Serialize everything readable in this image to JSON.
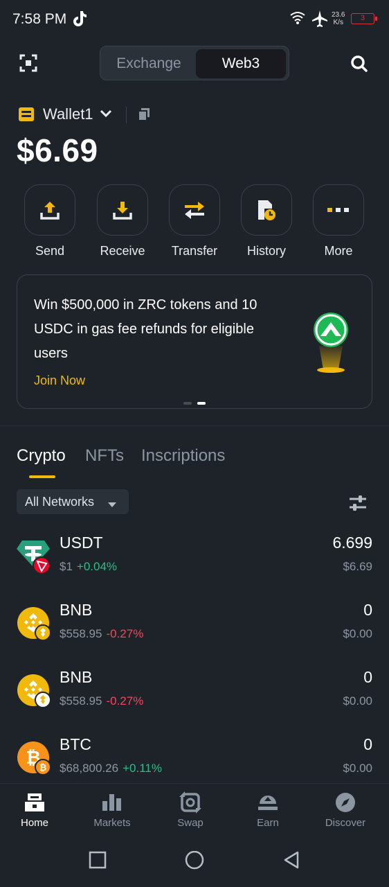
{
  "status_bar": {
    "time": "7:58 PM",
    "speed_value": "23.6",
    "speed_unit": "K/s",
    "battery": "3"
  },
  "header": {
    "tabs": [
      "Exchange",
      "Web3"
    ],
    "active_tab": "Web3"
  },
  "wallet": {
    "name": "Wallet1",
    "balance": "$6.69"
  },
  "actions": [
    {
      "label": "Send",
      "icon": "send-icon"
    },
    {
      "label": "Receive",
      "icon": "receive-icon"
    },
    {
      "label": "Transfer",
      "icon": "transfer-icon"
    },
    {
      "label": "History",
      "icon": "history-icon"
    },
    {
      "label": "More",
      "icon": "more-icon"
    }
  ],
  "promo": {
    "text": "Win $500,000 in ZRC tokens and 10 USDC in gas fee refunds for eligible users",
    "cta": "Join Now",
    "page_count": 2,
    "active_page": 2
  },
  "asset_tabs": [
    "Crypto",
    "NFTs",
    "Inscriptions"
  ],
  "network_filter": "All Networks",
  "assets": [
    {
      "name": "USDT",
      "price": "$1",
      "change": "+0.04%",
      "direction": "up",
      "amount": "6.699",
      "value": "$6.69"
    },
    {
      "name": "BNB",
      "price": "$558.95",
      "change": "-0.27%",
      "direction": "down",
      "amount": "0",
      "value": "$0.00"
    },
    {
      "name": "BNB",
      "price": "$558.95",
      "change": "-0.27%",
      "direction": "down",
      "amount": "0",
      "value": "$0.00"
    },
    {
      "name": "BTC",
      "price": "$68,800.26",
      "change": "+0.11%",
      "direction": "up",
      "amount": "0",
      "value": "$0.00"
    }
  ],
  "bottom_nav": [
    {
      "label": "Home",
      "icon": "home-icon",
      "active": true
    },
    {
      "label": "Markets",
      "icon": "markets-icon",
      "active": false
    },
    {
      "label": "Swap",
      "icon": "swap-icon",
      "active": false
    },
    {
      "label": "Earn",
      "icon": "earn-icon",
      "active": false
    },
    {
      "label": "Discover",
      "icon": "discover-icon",
      "active": false
    }
  ],
  "colors": {
    "accent": "#f0b90b",
    "background": "#1e2329",
    "up": "#2ebd85",
    "down": "#f6465d"
  }
}
